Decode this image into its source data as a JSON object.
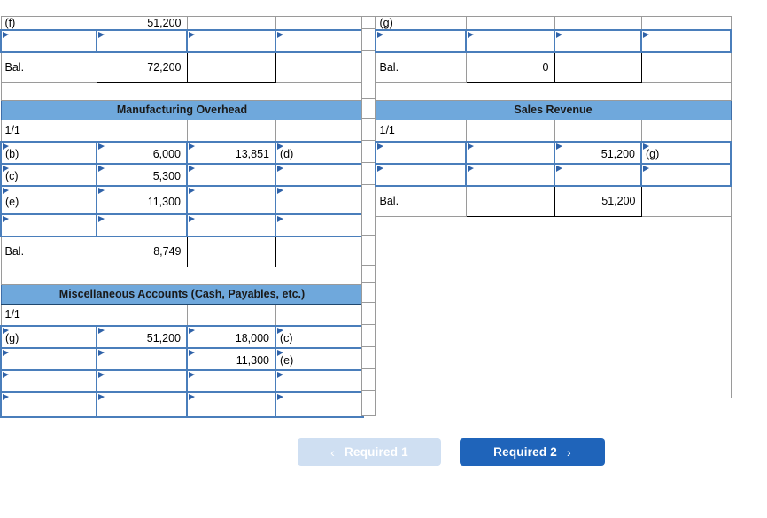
{
  "colors": {
    "section_header_bg": "#6FA8DC",
    "edit_border": "#4A7EBB",
    "grid_border": "#9A9A9A",
    "btn_next_bg": "#1F64BA",
    "btn_prev_bg": "#CFDFF2"
  },
  "left_panel": {
    "clipped_top_row": {
      "ref": "(f)",
      "debit": "51,200"
    },
    "top_account_balance": {
      "label": "Bal.",
      "debit": "72,200",
      "credit": ""
    },
    "accounts": [
      {
        "title": "Manufacturing Overhead",
        "opening_label": "1/1",
        "opening_debit": "",
        "opening_credit": "",
        "opening_ref": "",
        "rows": [
          {
            "ref": "(b)",
            "debit": "6,000",
            "credit": "13,851",
            "credit_ref": "(d)"
          },
          {
            "ref": "(c)",
            "debit": "5,300",
            "credit": "",
            "credit_ref": ""
          },
          {
            "ref": "(e)",
            "debit": "11,300",
            "credit": "",
            "credit_ref": ""
          },
          {
            "ref": "",
            "debit": "",
            "credit": "",
            "credit_ref": ""
          }
        ],
        "balance": {
          "label": "Bal.",
          "debit": "8,749",
          "credit": ""
        }
      },
      {
        "title": "Miscellaneous Accounts (Cash, Payables, etc.)",
        "opening_label": "1/1",
        "opening_debit": "",
        "opening_credit": "",
        "opening_ref": "",
        "rows": [
          {
            "ref": "(g)",
            "debit": "51,200",
            "credit": "18,000",
            "credit_ref": "(c)"
          },
          {
            "ref": "",
            "debit": "",
            "credit": "11,300",
            "credit_ref": "(e)"
          },
          {
            "ref": "",
            "debit": "",
            "credit": "",
            "credit_ref": ""
          },
          {
            "ref": "",
            "debit": "",
            "credit": "",
            "credit_ref": ""
          }
        ],
        "balance": null
      }
    ]
  },
  "right_panel": {
    "clipped_top_row": {
      "ref": "(g)"
    },
    "top_account_balance": {
      "label": "Bal.",
      "debit": "0",
      "credit": ""
    },
    "accounts": [
      {
        "title": "Sales Revenue",
        "opening_label": "1/1",
        "opening_debit": "",
        "opening_credit": "",
        "opening_ref": "",
        "rows": [
          {
            "ref": "",
            "debit": "",
            "credit": "51,200",
            "credit_ref": "(g)"
          },
          {
            "ref": "",
            "debit": "",
            "credit": "",
            "credit_ref": ""
          }
        ],
        "balance": {
          "label": "Bal.",
          "debit": "",
          "credit": "51,200"
        }
      }
    ]
  },
  "footer": {
    "prev_label": "Required 1",
    "next_label": "Required 2",
    "prev_icon": "chevron-left-icon",
    "next_icon": "chevron-right-icon",
    "prev_chevron": "‹",
    "next_chevron": "›"
  }
}
